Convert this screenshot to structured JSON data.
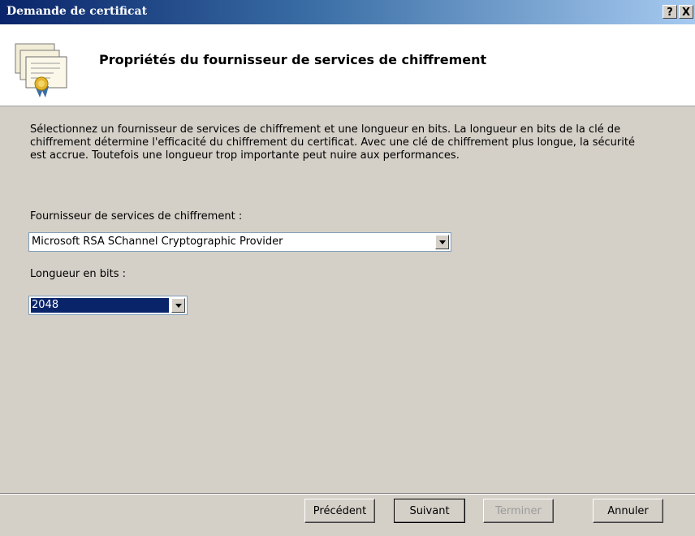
{
  "window": {
    "title": "Demande de certificat",
    "help_label": "?",
    "close_label": "X"
  },
  "header": {
    "title": "Propriétés du fournisseur de services de chiffrement"
  },
  "body": {
    "description": "Sélectionnez un fournisseur de services de chiffrement et une longueur en bits. La longueur en bits de la clé de chiffrement détermine l'efficacité du chiffrement du certificat. Avec une clé de chiffrement plus longue, la sécurité est accrue. Toutefois une longueur trop importante peut nuire aux performances.",
    "provider_label": "Fournisseur de services de chiffrement :",
    "provider_value": "Microsoft RSA SChannel Cryptographic Provider",
    "bits_label": "Longueur en bits :",
    "bits_value": "2048"
  },
  "buttons": {
    "previous": "Précédent",
    "next": "Suivant",
    "finish": "Terminer",
    "cancel": "Annuler",
    "finish_enabled": false
  },
  "icons": {
    "header": "certificate-icon",
    "dropdown": "dropdown-arrow-icon"
  },
  "colors": {
    "title_bar": "#0a246a",
    "dialog_background": "#d4d0c8",
    "selection": "#0a246a",
    "disabled_text": "#9a9a9a"
  }
}
